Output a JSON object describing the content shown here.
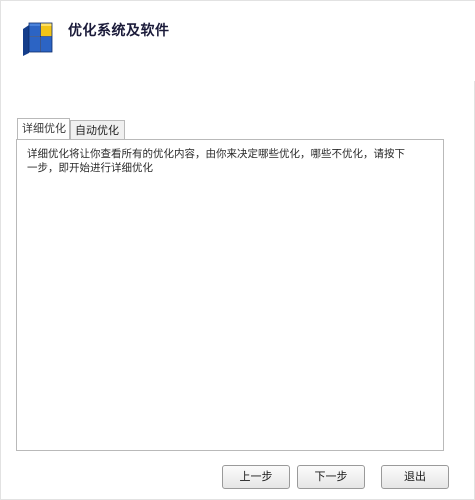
{
  "header": {
    "title": "优化系统及软件",
    "logo_icon": "windows-logo-icon"
  },
  "tabs": [
    {
      "label": "详细优化",
      "active": true
    },
    {
      "label": "自动优化",
      "active": false
    }
  ],
  "panel": {
    "description": "详细优化将让你查看所有的优化内容，由你来决定哪些优化，哪些不优化，请按下一步，即开始进行详细优化"
  },
  "buttons": {
    "prev_label": "上一步",
    "next_label": "下一步",
    "exit_label": "退出"
  },
  "colors": {
    "logo_blue": "#1f4fa6",
    "logo_yellow": "#f2c417",
    "border": "#b9b9b9"
  }
}
